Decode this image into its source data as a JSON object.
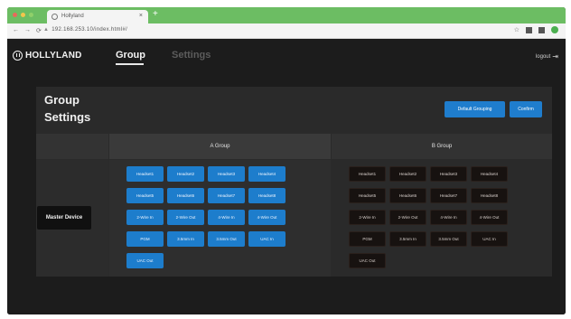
{
  "browser": {
    "tab_title": "Hollyland",
    "tab_close": "×",
    "new_tab": "+",
    "nav_back": "←",
    "nav_forward": "→",
    "nav_reload": "⟳",
    "nav_home": "⌂",
    "url": "192.168.253.10/index.html#/",
    "star": "☆"
  },
  "header": {
    "brand": "HOLLYLAND",
    "nav_group": "Group",
    "nav_settings": "Settings",
    "logout": "logout"
  },
  "card": {
    "title": "Group Settings",
    "default_grouping": "Default Grouping",
    "confirm": "Confirm",
    "a_group": "A Group",
    "b_group": "B Group",
    "master_device": "Master Device"
  },
  "group_a_items": [
    "Headset1",
    "Headset2",
    "Headset3",
    "Headset4",
    "Headset5",
    "Headset6",
    "Headset7",
    "Headset8",
    "2-Wire In",
    "2-Wire Out",
    "4-Wire In",
    "4-Wire Out",
    "PGM",
    "3.5mm In",
    "3.5mm Out",
    "UAC In",
    "UAC Out"
  ],
  "group_b_items": [
    "Headset1",
    "Headset2",
    "Headset3",
    "Headset4",
    "Headset5",
    "Headset6",
    "Headset7",
    "Headset8",
    "2-Wire In",
    "2-Wire Out",
    "4-Wire In",
    "4-Wire Out",
    "PGM",
    "3.5mm In",
    "3.5mm Out",
    "UAC In",
    "UAC Out"
  ],
  "colors": {
    "accent_blue": "#1d7dcc",
    "group_b_chip": "#171210",
    "tab_bar_green": "#6cbd63"
  }
}
